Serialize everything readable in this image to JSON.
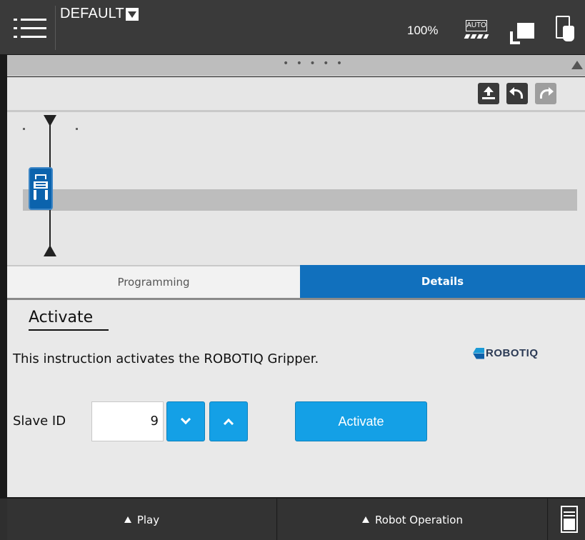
{
  "header": {
    "program_name": "DEFAULT",
    "speed": "100%",
    "mode_badge": "AUTO",
    "icons": [
      "hamburger-menu-icon",
      "dropdown-caret-icon",
      "auto-mode-icon",
      "teach-pendant-icon",
      "touch-panel-icon"
    ]
  },
  "strip": {
    "handle": "• • • • •"
  },
  "toolbar": {
    "icons": [
      "upload-icon",
      "undo-icon",
      "redo-icon"
    ]
  },
  "tabs": {
    "programming": "Programming",
    "details": "Details",
    "active": "details"
  },
  "details": {
    "title": "Activate",
    "description": "This instruction activates the ROBOTIQ Gripper.",
    "brand": "ROBOTIQ",
    "slave_label": "Slave ID",
    "slave_value": "9",
    "activate_label": "Activate"
  },
  "footer": {
    "play_label": "Play",
    "robot_operation_label": "Robot Operation"
  },
  "colors": {
    "accent": "#14a0e6",
    "tab_active": "#1170bd",
    "topbar": "#3a3a3a",
    "node": "#0b63ad"
  }
}
